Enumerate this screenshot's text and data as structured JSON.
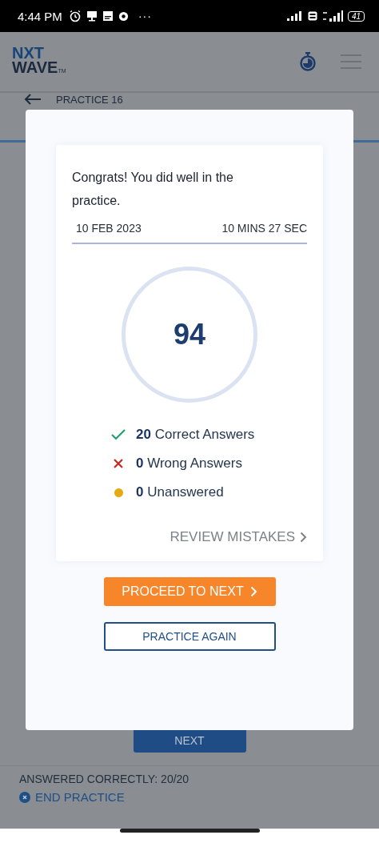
{
  "status_bar": {
    "time": "4:44 PM",
    "more": "···",
    "battery": "41"
  },
  "header": {
    "logo_top": "NXT",
    "logo_bottom": "WAVE",
    "logo_mark": "TM"
  },
  "practice": {
    "title": "PRACTICE 16"
  },
  "next_button": "NEXT",
  "footer": {
    "answered": "ANSWERED CORRECTLY: 20/20",
    "end": "END PRACTICE"
  },
  "result": {
    "message": "Congrats! You did well in the practice.",
    "date": "10 FEB 2023",
    "duration": "10 MINS 27 SEC",
    "score": "94",
    "stats": [
      {
        "kind": "correct",
        "count": "20",
        "label": "Correct Answers"
      },
      {
        "kind": "wrong",
        "count": "0",
        "label": "Wrong Answers"
      },
      {
        "kind": "unanswered",
        "count": "0",
        "label": "Unanswered"
      }
    ],
    "review": "REVIEW MISTAKES"
  },
  "buttons": {
    "proceed": "PROCEED TO NEXT",
    "again": "PRACTICE AGAIN"
  }
}
